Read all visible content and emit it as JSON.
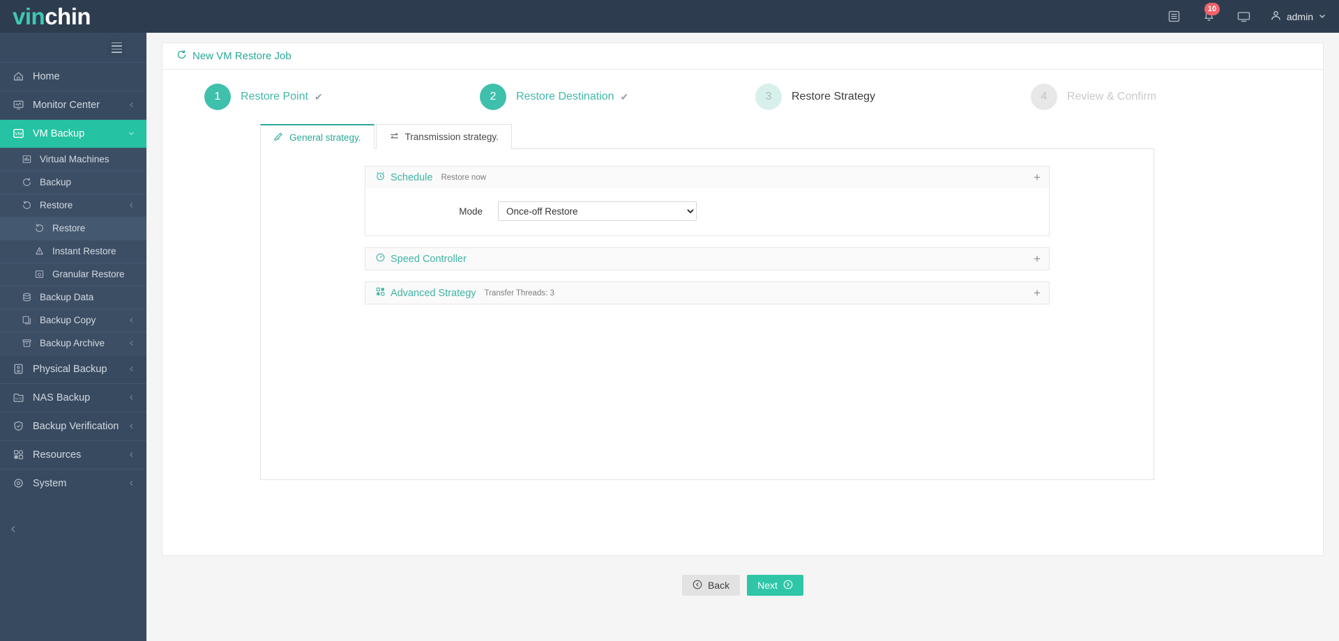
{
  "brand": {
    "part1": "vin",
    "part2": "chin"
  },
  "topbar": {
    "list_icon": "list-icon",
    "notification_icon": "bell-icon",
    "notification_count": "10",
    "monitor_icon": "monitor-icon",
    "user_icon": "user-icon",
    "username": "admin",
    "chevron": "chevron-down-icon"
  },
  "sidebar": {
    "toggle": "hamburger-icon",
    "collapse_icon": "chevron-left-icon",
    "items": [
      {
        "label": "Home",
        "icon": "home-icon",
        "level": 0,
        "active": false,
        "chevron": false
      },
      {
        "label": "Monitor Center",
        "icon": "monitor-chart-icon",
        "level": 0,
        "active": false,
        "chevron": true
      },
      {
        "label": "VM Backup",
        "icon": "vm-icon",
        "level": 0,
        "active": true,
        "chevron": true
      },
      {
        "label": "Virtual Machines",
        "icon": "virtual-machines-icon",
        "level": 1,
        "active": false,
        "chevron": false
      },
      {
        "label": "Backup",
        "icon": "backup-icon",
        "level": 1,
        "active": false,
        "chevron": false
      },
      {
        "label": "Restore",
        "icon": "restore-icon",
        "level": 1,
        "active": false,
        "chevron": true
      },
      {
        "label": "Restore",
        "icon": "restore-icon",
        "level": 2,
        "active": true,
        "chevron": false
      },
      {
        "label": "Instant Restore",
        "icon": "instant-restore-icon",
        "level": 2,
        "active": false,
        "chevron": false
      },
      {
        "label": "Granular Restore",
        "icon": "granular-restore-icon",
        "level": 2,
        "active": false,
        "chevron": false
      },
      {
        "label": "Backup Data",
        "icon": "database-icon",
        "level": 1,
        "active": false,
        "chevron": false
      },
      {
        "label": "Backup Copy",
        "icon": "copy-icon",
        "level": 1,
        "active": false,
        "chevron": true
      },
      {
        "label": "Backup Archive",
        "icon": "archive-icon",
        "level": 1,
        "active": false,
        "chevron": true
      },
      {
        "label": "Physical Backup",
        "icon": "server-icon",
        "level": 0,
        "active": false,
        "chevron": true
      },
      {
        "label": "NAS Backup",
        "icon": "nas-icon",
        "level": 0,
        "active": false,
        "chevron": true
      },
      {
        "label": "Backup Verification",
        "icon": "verification-icon",
        "level": 0,
        "active": false,
        "chevron": true
      },
      {
        "label": "Resources",
        "icon": "resources-icon",
        "level": 0,
        "active": false,
        "chevron": true
      },
      {
        "label": "System",
        "icon": "system-gear-icon",
        "level": 0,
        "active": false,
        "chevron": true
      }
    ]
  },
  "page": {
    "title": "New VM Restore Job",
    "title_icon": "restore-circle-icon"
  },
  "steps": [
    {
      "num": "1",
      "label": "Restore Point",
      "state": "done",
      "check": "✔"
    },
    {
      "num": "2",
      "label": "Restore Destination",
      "state": "done",
      "check": "✔"
    },
    {
      "num": "3",
      "label": "Restore Strategy",
      "state": "current",
      "check": ""
    },
    {
      "num": "4",
      "label": "Review & Confirm",
      "state": "disabled",
      "check": ""
    }
  ],
  "tabs": [
    {
      "label": "General strategy.",
      "icon": "pencil-icon",
      "active": true
    },
    {
      "label": "Transmission strategy.",
      "icon": "transfer-icon",
      "active": false
    }
  ],
  "sections": [
    {
      "title": "Schedule",
      "icon": "clock-icon",
      "subtitle": "Restore now",
      "expand": "+",
      "expanded": true,
      "field": {
        "label": "Mode",
        "value": "Once-off Restore",
        "options": [
          "Once-off Restore"
        ]
      }
    },
    {
      "title": "Speed Controller",
      "icon": "speedometer-icon",
      "subtitle": "",
      "expand": "+",
      "expanded": false
    },
    {
      "title": "Advanced Strategy",
      "icon": "grid-icon",
      "subtitle": "Transfer Threads: 3",
      "expand": "+",
      "expanded": false
    }
  ],
  "footer": {
    "back_label": "Back",
    "back_icon": "arrow-left-circle-icon",
    "next_label": "Next",
    "next_icon": "arrow-right-circle-icon"
  },
  "colors": {
    "brand_teal": "#2ec6a6",
    "sidebar_bg": "#384a5f",
    "topbar_bg": "#2e3c4f",
    "badge_red": "#f1636a",
    "step_teal": "#3fc0ad"
  }
}
